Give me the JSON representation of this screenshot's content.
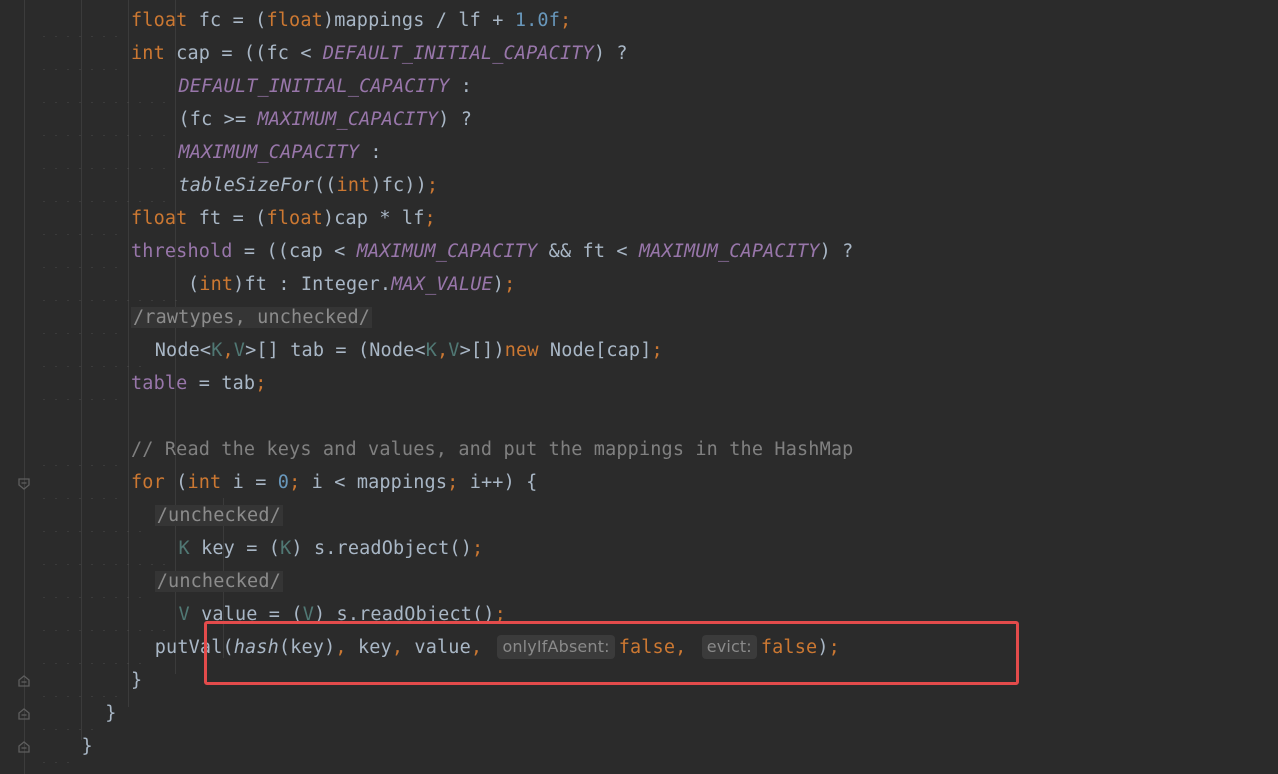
{
  "editor": {
    "lines": [
      {
        "indent": 2,
        "tokens": [
          [
            "kw",
            "float"
          ],
          [
            "t",
            " fc = ("
          ],
          [
            "kw",
            "float"
          ],
          [
            "t",
            ")mappings / lf + "
          ],
          [
            "num",
            "1.0f"
          ],
          [
            "semi",
            ";"
          ]
        ]
      },
      {
        "indent": 2,
        "tokens": [
          [
            "kw",
            "int"
          ],
          [
            "t",
            " cap = ((fc < "
          ],
          [
            "const",
            "DEFAULT_INITIAL_CAPACITY"
          ],
          [
            "t",
            ") ?"
          ]
        ]
      },
      {
        "indent": 3,
        "tokens": [
          [
            "const",
            "DEFAULT_INITIAL_CAPACITY"
          ],
          [
            "t",
            " :"
          ]
        ]
      },
      {
        "indent": 3,
        "tokens": [
          [
            "t",
            "(fc >= "
          ],
          [
            "const",
            "MAXIMUM_CAPACITY"
          ],
          [
            "t",
            ") ?"
          ]
        ]
      },
      {
        "indent": 3,
        "tokens": [
          [
            "const",
            "MAXIMUM_CAPACITY"
          ],
          [
            "t",
            " :"
          ]
        ]
      },
      {
        "indent": 3,
        "tokens": [
          [
            "fn",
            "tableSizeFor"
          ],
          [
            "t",
            "(("
          ],
          [
            "kw",
            "int"
          ],
          [
            "t",
            ")fc))"
          ],
          [
            "semi",
            ";"
          ]
        ]
      },
      {
        "indent": 2,
        "tokens": [
          [
            "kw",
            "float"
          ],
          [
            "t",
            " ft = ("
          ],
          [
            "kw",
            "float"
          ],
          [
            "t",
            ")cap * lf"
          ],
          [
            "semi",
            ";"
          ]
        ]
      },
      {
        "indent": 2,
        "tokens": [
          [
            "fld",
            "threshold"
          ],
          [
            "t",
            " = ((cap < "
          ],
          [
            "const",
            "MAXIMUM_CAPACITY"
          ],
          [
            "t",
            " && ft < "
          ],
          [
            "const",
            "MAXIMUM_CAPACITY"
          ],
          [
            "t",
            ") ?"
          ]
        ]
      },
      {
        "indent": 3.2,
        "tokens": [
          [
            "t",
            "("
          ],
          [
            "kw",
            "int"
          ],
          [
            "t",
            ")ft : Integer."
          ],
          [
            "const",
            "MAX_VALUE"
          ],
          [
            "t",
            ")"
          ],
          [
            "semi",
            ";"
          ]
        ]
      },
      {
        "indent": 2,
        "tokens": [
          [
            "sup",
            "/rawtypes, unchecked/"
          ]
        ]
      },
      {
        "indent": 2.5,
        "tokens": [
          [
            "t",
            "Node<"
          ],
          [
            "tp",
            "K"
          ],
          [
            "semi",
            ","
          ],
          [
            "tp",
            "V"
          ],
          [
            "t",
            ">[] tab = (Node<"
          ],
          [
            "tp",
            "K"
          ],
          [
            "semi",
            ","
          ],
          [
            "tp",
            "V"
          ],
          [
            "t",
            ">[])"
          ],
          [
            "kw",
            "new"
          ],
          [
            "t",
            " Node[cap]"
          ],
          [
            "semi",
            ";"
          ]
        ]
      },
      {
        "indent": 2,
        "tokens": [
          [
            "fld",
            "table"
          ],
          [
            "t",
            " = tab"
          ],
          [
            "semi",
            ";"
          ]
        ]
      },
      {
        "indent": 2,
        "tokens": []
      },
      {
        "indent": 2,
        "tokens": [
          [
            "cmt",
            "// Read the keys and values, and put the mappings in the HashMap"
          ]
        ]
      },
      {
        "indent": 2,
        "tokens": [
          [
            "kw",
            "for"
          ],
          [
            "t",
            " ("
          ],
          [
            "kw",
            "int"
          ],
          [
            "t",
            " i = "
          ],
          [
            "num",
            "0"
          ],
          [
            "semi",
            ";"
          ],
          [
            "t",
            " i < mappings"
          ],
          [
            "semi",
            ";"
          ],
          [
            "t",
            " i++) {"
          ]
        ]
      },
      {
        "indent": 2.5,
        "tokens": [
          [
            "sup",
            "/unchecked/"
          ]
        ]
      },
      {
        "indent": 3,
        "tokens": [
          [
            "tp",
            "K"
          ],
          [
            "t",
            " key = ("
          ],
          [
            "tp",
            "K"
          ],
          [
            "t",
            ") s.readObject()"
          ],
          [
            "semi",
            ";"
          ]
        ]
      },
      {
        "indent": 2.5,
        "tokens": [
          [
            "sup",
            "/unchecked/"
          ]
        ]
      },
      {
        "indent": 3,
        "tokens": [
          [
            "tp",
            "V"
          ],
          [
            "t",
            " value = ("
          ],
          [
            "tp",
            "V"
          ],
          [
            "t",
            ") s.readObject()"
          ],
          [
            "semi",
            ";"
          ]
        ]
      },
      {
        "indent": 2.5,
        "tokens": [
          [
            "t",
            "putVal("
          ],
          [
            "fn",
            "hash"
          ],
          [
            "t",
            "(key)"
          ],
          [
            "semi",
            ","
          ],
          [
            "t",
            " key"
          ],
          [
            "semi",
            ","
          ],
          [
            "t",
            " value"
          ],
          [
            "semi",
            ","
          ],
          [
            "t",
            " "
          ],
          [
            "hint",
            "onlyIfAbsent:"
          ],
          [
            "kw",
            "false"
          ],
          [
            "semi",
            ","
          ],
          [
            "t",
            " "
          ],
          [
            "hint",
            "evict:"
          ],
          [
            "kw",
            "false"
          ],
          [
            "t",
            ")"
          ],
          [
            "semi",
            ";"
          ]
        ]
      },
      {
        "indent": 2,
        "tokens": [
          [
            "t",
            "}"
          ]
        ]
      },
      {
        "indent": 1.5,
        "tokens": [
          [
            "t",
            "}"
          ]
        ]
      },
      {
        "indent": 1,
        "tokens": [
          [
            "t",
            "}"
          ]
        ]
      }
    ]
  },
  "colors": {
    "background": "#2b2b2b",
    "keyword": "#cc7832",
    "constant": "#9876aa",
    "number": "#6897bb",
    "comment": "#808080",
    "highlight_box": "#e34b4b"
  }
}
